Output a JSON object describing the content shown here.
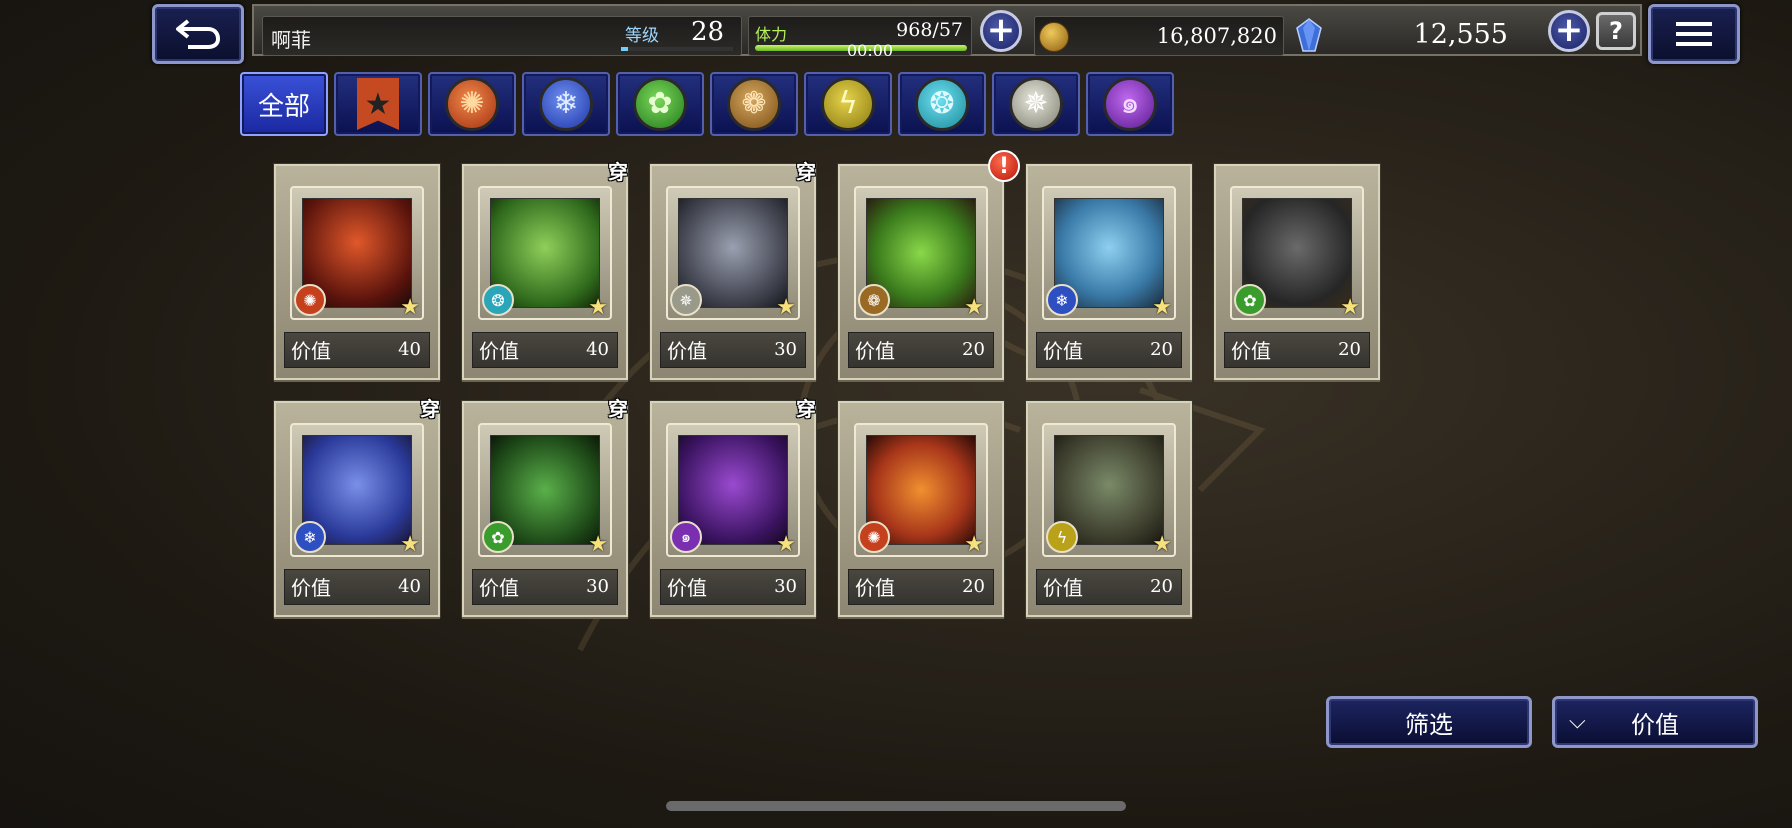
{
  "header": {
    "back_icon": "return-arrow-icon",
    "player_name": "啊菲",
    "level_label": "等级",
    "level_value": "28",
    "stamina_label": "体力",
    "stamina_value": "968/57",
    "stamina_timer": "00:00",
    "stamina_fill": 1.0,
    "gil_value": "16,807,820",
    "gems_value": "12,555",
    "help_icon": "question-icon",
    "menu_icon": "menu-icon"
  },
  "filters": {
    "all_label": "全部",
    "element_icons": [
      "favorite-star-icon",
      "fire-icon",
      "ice-icon",
      "wind-icon",
      "earth-icon",
      "lightning-icon",
      "water-icon",
      "holy-icon",
      "dark-icon"
    ]
  },
  "cards": [
    {
      "value_label": "价值",
      "value": "40",
      "element": "fire",
      "worn": "",
      "alert": false
    },
    {
      "value_label": "价值",
      "value": "40",
      "element": "water",
      "worn": "穿",
      "alert": false
    },
    {
      "value_label": "价值",
      "value": "30",
      "element": "holy",
      "worn": "穿",
      "alert": false
    },
    {
      "value_label": "价值",
      "value": "20",
      "element": "earth",
      "worn": "",
      "alert": true
    },
    {
      "value_label": "价值",
      "value": "20",
      "element": "ice",
      "worn": "",
      "alert": false
    },
    {
      "value_label": "价值",
      "value": "20",
      "element": "wind",
      "worn": "",
      "alert": false
    },
    {
      "value_label": "价值",
      "value": "40",
      "element": "ice",
      "worn": "穿",
      "alert": false
    },
    {
      "value_label": "价值",
      "value": "30",
      "element": "wind",
      "worn": "穿",
      "alert": false
    },
    {
      "value_label": "价值",
      "value": "30",
      "element": "dark",
      "worn": "穿",
      "alert": false
    },
    {
      "value_label": "价值",
      "value": "20",
      "element": "fire",
      "worn": "",
      "alert": false
    },
    {
      "value_label": "价值",
      "value": "20",
      "element": "lightning",
      "worn": "",
      "alert": false
    }
  ],
  "footer": {
    "filter_label": "筛选",
    "sort_label": "价值",
    "sort_icon": "chevron-down-icon"
  },
  "colors": {
    "fire": "#c5401c",
    "ice": "#2d4fc2",
    "wind": "#3a9c2c",
    "earth": "#9a6a24",
    "lightning": "#b9a21a",
    "water": "#2aa6b8",
    "holy": "#9a9a8a",
    "dark": "#7a2fb0"
  }
}
